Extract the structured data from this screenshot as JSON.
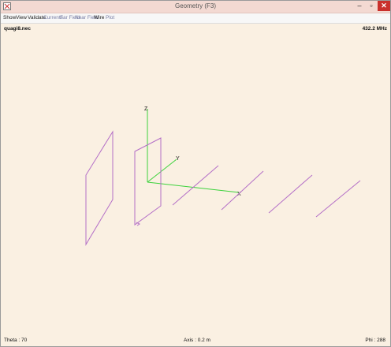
{
  "window": {
    "title": "Geometry  (F3)",
    "controls": {
      "minimize": "–",
      "maximize": "▫",
      "close": "✕"
    }
  },
  "menu": {
    "items": [
      {
        "label": "Show",
        "dim": false
      },
      {
        "label": "View",
        "dim": false
      },
      {
        "label": "Validate",
        "dim": false
      },
      {
        "label": "Currents",
        "dim": true
      },
      {
        "label": "Far Field",
        "dim": true
      },
      {
        "label": "Near Field",
        "dim": true
      },
      {
        "label": "Wire",
        "dim": false
      },
      {
        "label": "Plot",
        "dim": true
      }
    ]
  },
  "canvas": {
    "filename": "quagi8.nec",
    "frequency": "432.2 MHz",
    "theta": "Theta : 70",
    "axis": "Axis : 0.2 m",
    "phi": "Phi : 288",
    "axis_labels": {
      "z": "Z",
      "y": "Y",
      "x": "X"
    }
  },
  "colors": {
    "wire": "#b46fc7",
    "axis_x": "#3cd23c",
    "axis_y": "#3cd23c",
    "axis_z": "#3cd23c",
    "background": "#faf0e2"
  }
}
